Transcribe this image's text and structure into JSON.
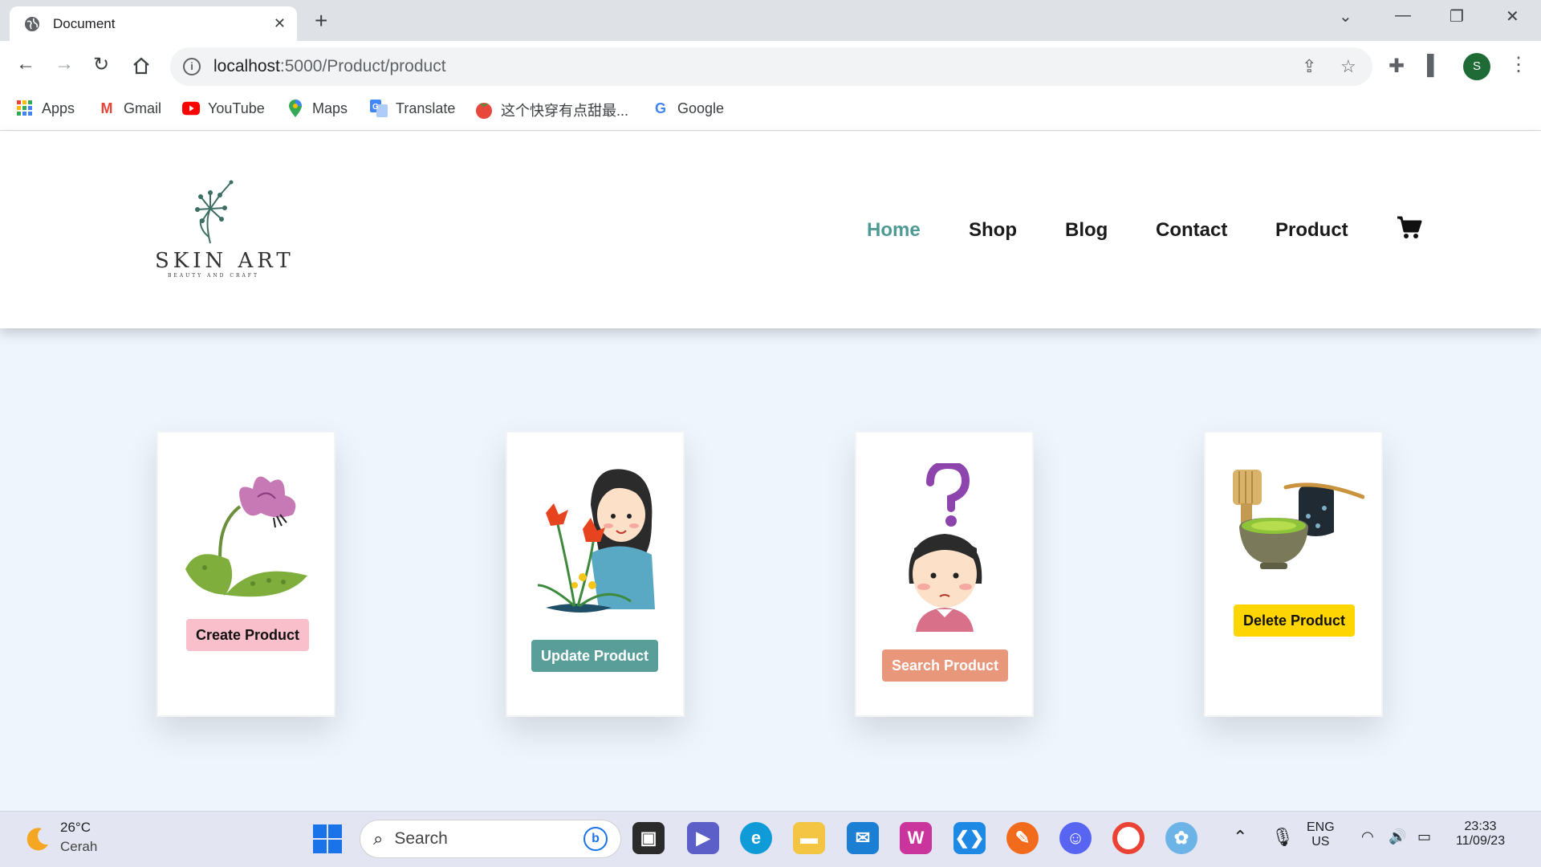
{
  "browser": {
    "tab_title": "Document",
    "url_host": "localhost",
    "url_path": ":5000/Product/product",
    "profile_initial": "S",
    "bookmarks": [
      "Apps",
      "Gmail",
      "YouTube",
      "Maps",
      "Translate",
      "这个快穿有点甜最...",
      "Google"
    ]
  },
  "site": {
    "logo_name": "SKIN ART",
    "logo_tagline": "BEAUTY AND CRAFT",
    "nav": [
      "Home",
      "Shop",
      "Blog",
      "Contact",
      "Product"
    ],
    "active_nav": "Home",
    "accent_color": "#4f9a94"
  },
  "cards": [
    {
      "illustration": "flower-icon",
      "button": "Create Product",
      "button_color": "#f9c0cb",
      "button_text_color": "#111111"
    },
    {
      "illustration": "girl-with-flowers-icon",
      "button": "Update Product",
      "button_color": "#5a9e9a",
      "button_text_color": "#ffffff"
    },
    {
      "illustration": "confused-girl-icon",
      "button": "Search Product",
      "button_color": "#e8977a",
      "button_text_color": "#ffffff"
    },
    {
      "illustration": "matcha-bowl-icon",
      "button": "Delete Product",
      "button_color": "#ffd500",
      "button_text_color": "#111111"
    }
  ],
  "taskbar": {
    "weather_temp": "26°C",
    "weather_desc": "Cerah",
    "search_label": "Search",
    "language": "ENG",
    "region": "US",
    "time": "23:33",
    "date": "11/09/23"
  }
}
